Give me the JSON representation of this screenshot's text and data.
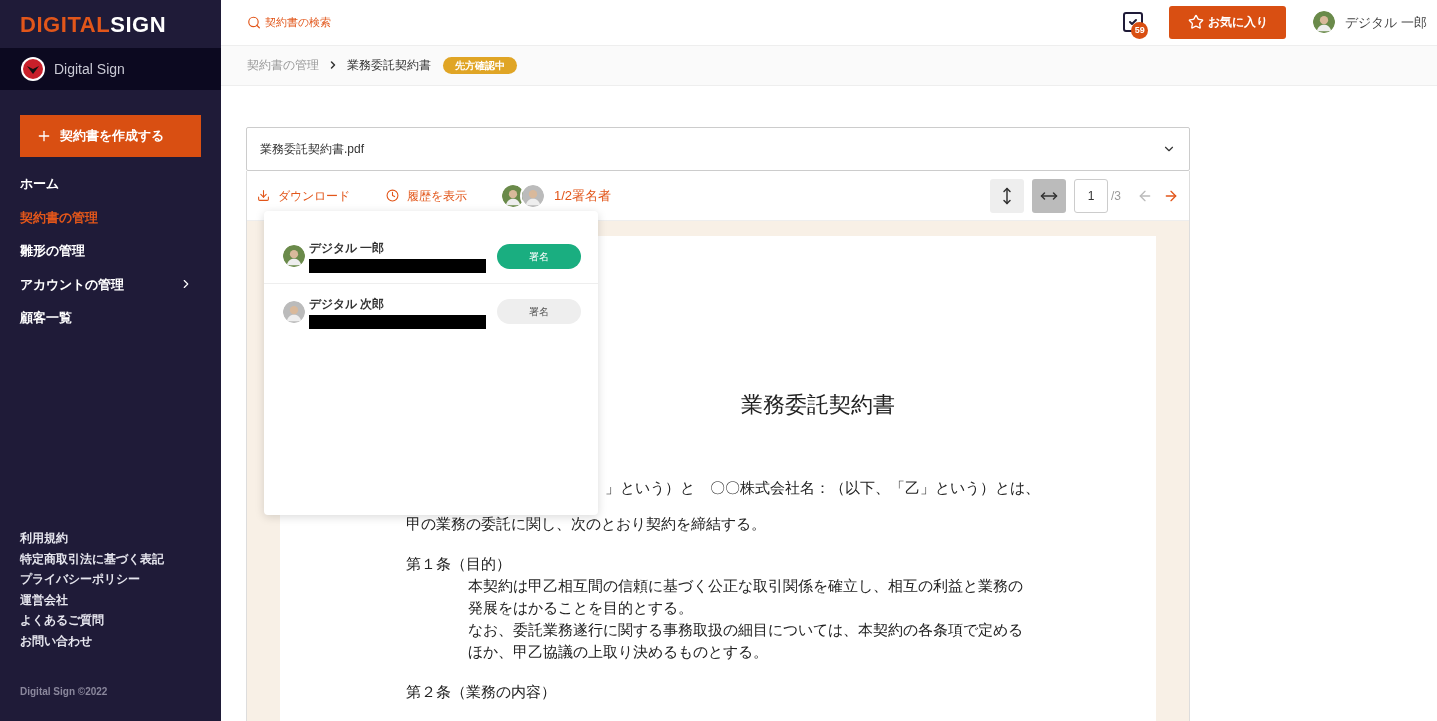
{
  "sidebar": {
    "logo": {
      "part1": "DIGITAL",
      "part2": "SIGN"
    },
    "org": "Digital Sign",
    "create_button": "契約書を作成する",
    "items": [
      {
        "label": "ホーム",
        "selected": false,
        "has_children": false
      },
      {
        "label": "契約書の管理",
        "selected": true,
        "has_children": false
      },
      {
        "label": "雛形の管理",
        "selected": false,
        "has_children": false
      },
      {
        "label": "アカウントの管理",
        "selected": false,
        "has_children": true
      },
      {
        "label": "顧客一覧",
        "selected": false,
        "has_children": false
      }
    ],
    "footer_links": [
      "利用規約",
      "特定商取引法に基づく表記",
      "プライバシーポリシー",
      "運営会社",
      "よくあるご質問",
      "お問い合わせ"
    ],
    "copyright": "Digital Sign ©2022"
  },
  "header": {
    "search": {
      "placeholder": "契約書の検索"
    },
    "task_badge": "59",
    "favorite_button": "お気に入り",
    "user_name": "デジタル 一郎"
  },
  "breadcrumb": {
    "items": [
      "契約書の管理",
      "業務委託契約書"
    ],
    "status": "先方確認中"
  },
  "file_select": {
    "value": "業務委託契約書.pdf"
  },
  "toolbar": {
    "download": "ダウンロード",
    "history": "履歴を表示",
    "signers_summary": "1/2署名者",
    "fit_height_selected": false,
    "fit_width_selected": true,
    "page": "1",
    "page_total": "/3",
    "prev_enabled": false,
    "next_enabled": true
  },
  "signers": [
    {
      "name": "デジタル 一郎",
      "signed": true,
      "button": "署名"
    },
    {
      "name": "デジタル 次郎",
      "signed": false,
      "button": "署名"
    }
  ],
  "document": {
    "title": "業務委託契約書",
    "intro": [
      "」という）と　〇〇株式会社名：（以下、「乙」という）とは、",
      "甲の業務の委託に関し、次のとおり契約を締結する。"
    ],
    "articles": [
      {
        "heading": "第１条（目的）",
        "paragraphs": [
          "本契約は甲乙相互間の信頼に基づく公正な取引関係を確立し、相互の利益と業務の発展をはかることを目的とする。",
          "なお、委託業務遂行に関する事務取扱の細目については、本契約の各条項で定めるほか、甲乙協議の上取り決めるものとする。"
        ]
      },
      {
        "heading": "第２条（業務の内容）"
      }
    ]
  }
}
